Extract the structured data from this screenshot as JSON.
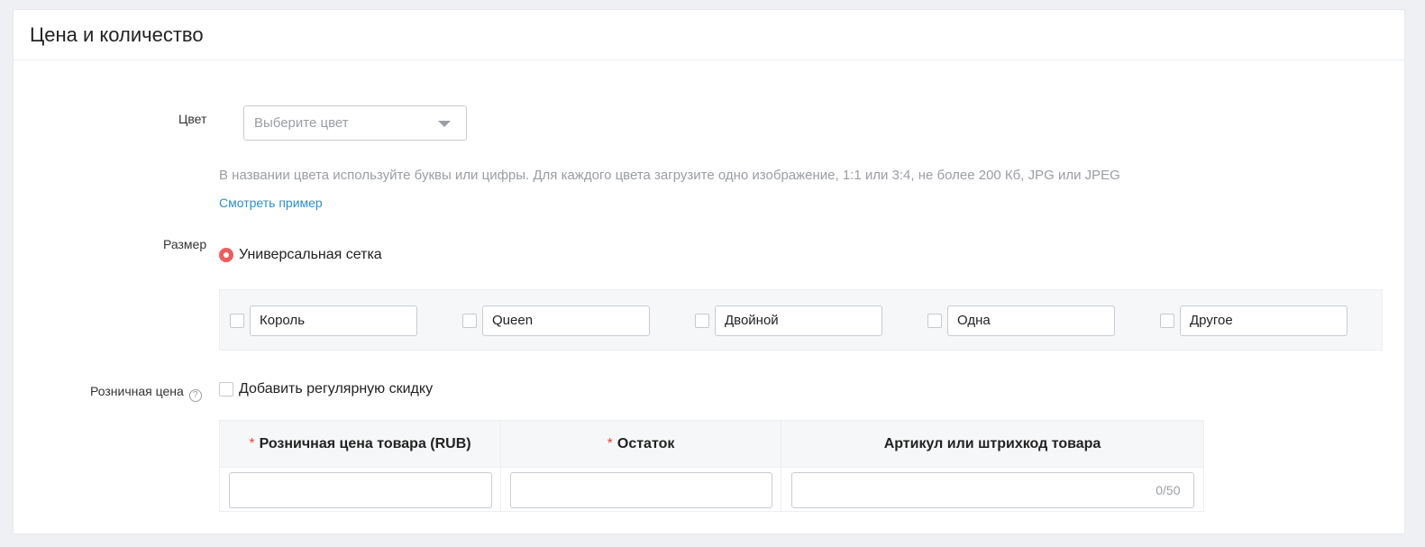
{
  "section": {
    "title": "Цена и количество"
  },
  "color": {
    "label": "Цвет",
    "placeholder": "Выберите цвет",
    "hint": "В названии цвета используйте буквы или цифры. Для каждого цвета загрузите одно изображение, 1:1 или 3:4, не более 200 Кб, JPG или JPEG",
    "example_link": "Смотреть пример"
  },
  "size": {
    "label": "Размер",
    "grid_option": "Универсальная сетка",
    "items": [
      {
        "value": "Король",
        "checked": false
      },
      {
        "value": "Queen",
        "checked": false
      },
      {
        "value": "Двойной",
        "checked": false
      },
      {
        "value": "Одна",
        "checked": false
      },
      {
        "value": "Другое",
        "checked": false
      }
    ]
  },
  "price": {
    "label": "Розничная цена",
    "help_icon": "question-circle-icon",
    "discount_option": "Добавить регулярную скидку",
    "columns": [
      {
        "label": "Розничная цена товара (RUB)",
        "required": true
      },
      {
        "label": "Остаток",
        "required": true
      },
      {
        "label": "Артикул или штрихкод товара",
        "required": false
      }
    ],
    "required_mark": "*",
    "sku_counter": "0/50"
  },
  "colors": {
    "accent": "#f05b5b",
    "link": "#2d8fc9",
    "required": "#e8473b"
  }
}
